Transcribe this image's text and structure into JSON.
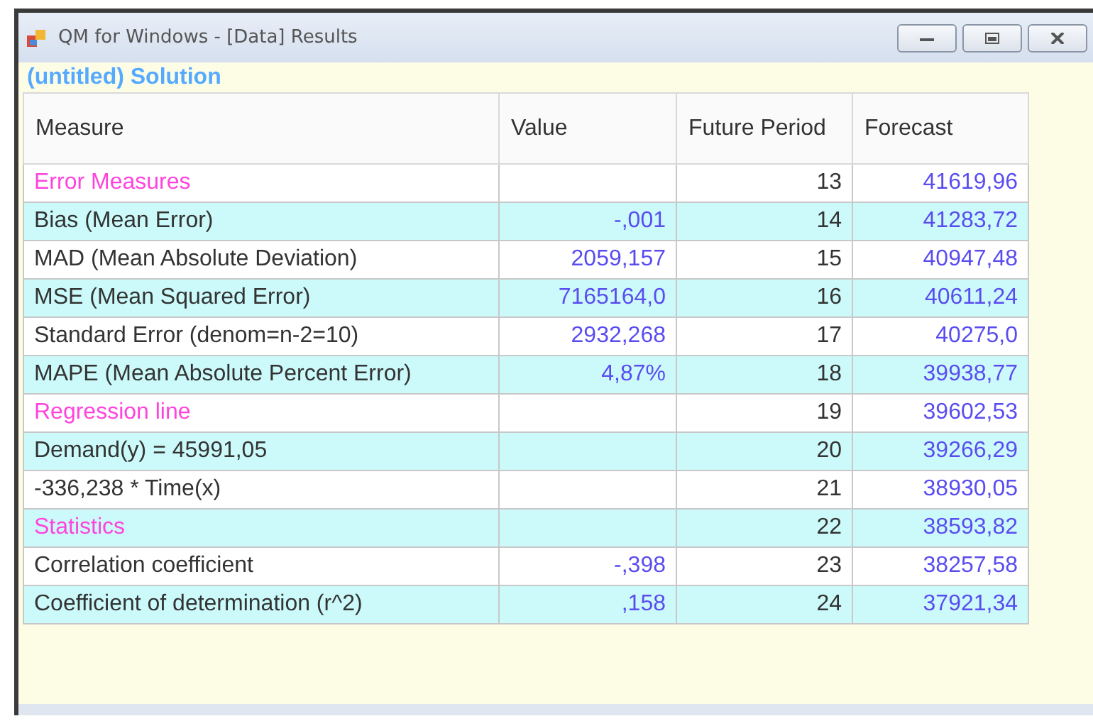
{
  "window": {
    "title": "QM for Windows - [Data] Results"
  },
  "heading": "(untitled) Solution",
  "table": {
    "columns": [
      "Measure",
      "Value",
      "Future Period",
      "Forecast"
    ],
    "rows": [
      {
        "kind": "section",
        "measure": "Error Measures",
        "period": "13",
        "forecast": "41619,96"
      },
      {
        "kind": "item",
        "measure": "Bias (Mean Error)",
        "value": "-,001",
        "period": "14",
        "forecast": "41283,72"
      },
      {
        "kind": "item",
        "measure": "MAD (Mean Absolute Deviation)",
        "value": "2059,157",
        "period": "15",
        "forecast": "40947,48"
      },
      {
        "kind": "item",
        "measure": "MSE (Mean Squared Error)",
        "value": "7165164,0",
        "period": "16",
        "forecast": "40611,24"
      },
      {
        "kind": "item",
        "measure": "Standard Error (denom=n-2=10)",
        "value": "2932,268",
        "period": "17",
        "forecast": "40275,0"
      },
      {
        "kind": "item",
        "measure": "MAPE (Mean Absolute Percent Error)",
        "value": "4,87%",
        "period": "18",
        "forecast": "39938,77"
      },
      {
        "kind": "section",
        "measure": "Regression line",
        "period": "19",
        "forecast": "39602,53"
      },
      {
        "kind": "item",
        "measure": "Demand(y) = 45991,05",
        "period": "20",
        "forecast": "39266,29"
      },
      {
        "kind": "item",
        "measure": "-336,238 * Time(x)",
        "period": "21",
        "forecast": "38930,05"
      },
      {
        "kind": "section",
        "measure": "Statistics",
        "period": "22",
        "forecast": "38593,82"
      },
      {
        "kind": "item",
        "measure": "Correlation coefficient",
        "value": "-,398",
        "period": "23",
        "forecast": "38257,58"
      },
      {
        "kind": "item",
        "measure": "Coefficient of determination (r^2)",
        "value": ",158",
        "period": "24",
        "forecast": "37921,34"
      }
    ]
  }
}
